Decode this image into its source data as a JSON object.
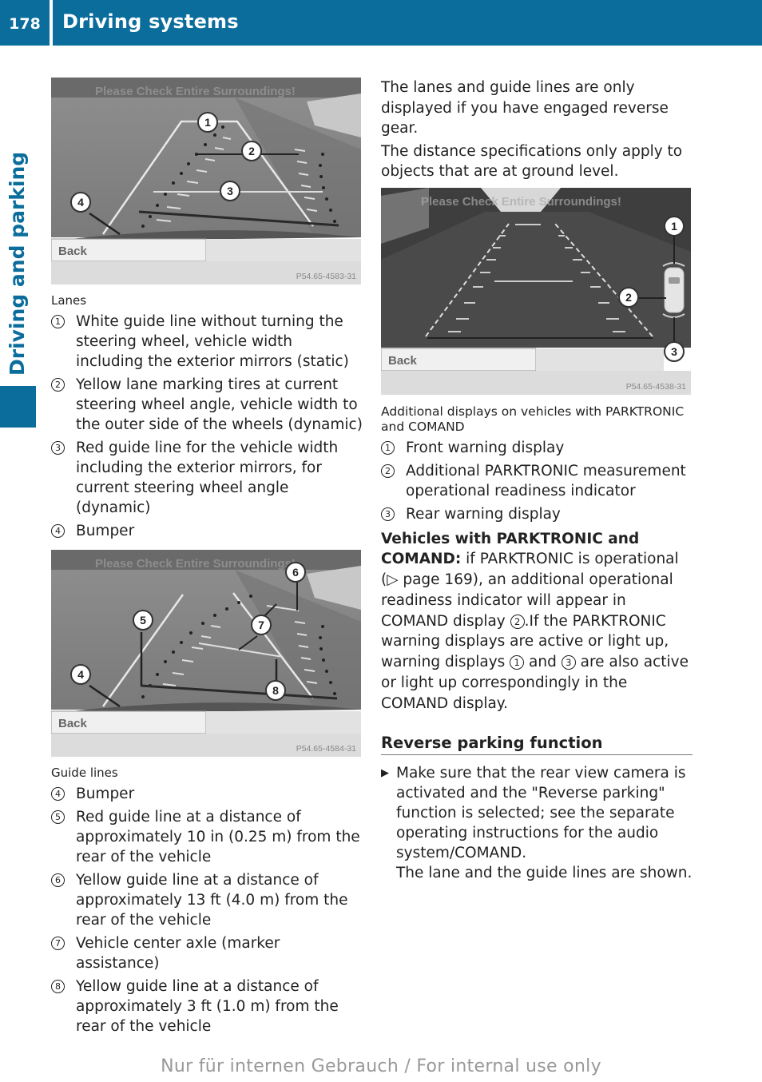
{
  "header": {
    "page_number": "178",
    "section_title": "Driving systems"
  },
  "side_tab": {
    "label": "Driving and parking",
    "color": "#0a6d9c"
  },
  "figures": {
    "lanes": {
      "overlay_text": "Please Check Entire Surroundings!",
      "back_label": "Back",
      "image_code": "P54.65-4583-31",
      "markers": [
        "1",
        "2",
        "3",
        "4"
      ]
    },
    "guide_lines": {
      "overlay_text": "Please Check Entire Surroundings!",
      "back_label": "Back",
      "image_code": "P54.65-4584-31",
      "markers": [
        "4",
        "5",
        "6",
        "7",
        "8"
      ]
    },
    "parktronic": {
      "overlay_text": "Please Check Entire Surroundings!",
      "back_label": "Back",
      "image_code": "P54.65-4538-31",
      "markers": [
        "1",
        "2",
        "3"
      ]
    }
  },
  "left_column": {
    "lanes_caption": "Lanes",
    "lanes_items": [
      {
        "num": "1",
        "text": "White guide line without turning the steering wheel, vehicle width including the exterior mirrors (static)"
      },
      {
        "num": "2",
        "text": "Yellow lane marking tires at current steering wheel angle, vehicle width to the outer side of the wheels (dynamic)"
      },
      {
        "num": "3",
        "text": "Red guide line for the vehicle width including the exterior mirrors, for current steering wheel angle (dynamic)"
      },
      {
        "num": "4",
        "text": "Bumper"
      }
    ],
    "guide_caption": "Guide lines",
    "guide_items": [
      {
        "num": "4",
        "text": "Bumper"
      },
      {
        "num": "5",
        "text": "Red guide line at a distance of approximately 10 in (0.25 m) from the rear of the vehicle"
      },
      {
        "num": "6",
        "text": "Yellow guide line at a distance of approximately 13 ft (4.0 m) from the rear of the vehicle"
      },
      {
        "num": "7",
        "text": "Vehicle center axle (marker assistance)"
      },
      {
        "num": "8",
        "text": "Yellow guide line at a distance of approximately 3 ft (1.0 m) from the rear of the vehicle"
      }
    ]
  },
  "right_column": {
    "intro_1": "The lanes and guide lines are only displayed if you have engaged reverse gear.",
    "intro_2": "The distance specifications only apply to objects that are at ground level.",
    "parktronic_caption": "Additional displays on vehicles with PARKTRONIC and COMAND",
    "parktronic_items": [
      {
        "num": "1",
        "text": "Front warning display"
      },
      {
        "num": "2",
        "text": "Additional PARKTRONIC measurement operational readiness indicator"
      },
      {
        "num": "3",
        "text": "Rear warning display"
      }
    ],
    "vehicles_para": {
      "bold_lead": "Vehicles with PARKTRONIC and COMAND:",
      "text_a": " if PARKTRONIC is operational (",
      "page_ref_arrow": "▷",
      "page_ref": " page 169",
      "text_b": "), an additional operational readiness indicator will appear in COMAND display ",
      "ref_num_a": "2",
      "text_c": ".If the PARKTRONIC warning displays are active or light up, warning displays ",
      "ref_num_b": "1",
      "text_d": " and ",
      "ref_num_c": "3",
      "text_e": " are also active or light up correspondingly in the COMAND display."
    },
    "heading": "Reverse parking function",
    "step_arrow": "▶",
    "step_text": "Make sure that the rear view camera is activated and the \"Reverse parking\" function is selected; see the separate operating instructions for the audio system/COMAND.",
    "step_result": "The lane and the guide lines are shown."
  },
  "footer": {
    "watermark": "Nur für internen Gebrauch / For internal use only"
  }
}
